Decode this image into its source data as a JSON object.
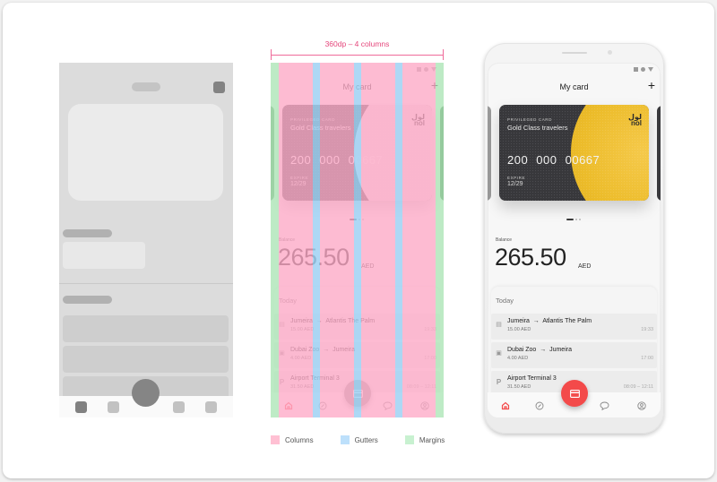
{
  "wireframe": {
    "transaction_rows": 3,
    "nav_items": 4,
    "active_nav_index": 0
  },
  "grid_spec": {
    "measure_label": "360dp – 4 columns",
    "columns": 4,
    "colors": {
      "columns": "#ffb6cc",
      "gutters": "#b4dbfa",
      "margins": "#c3efcc",
      "measure": "#ef6b9a"
    }
  },
  "legend": {
    "items": [
      {
        "label": "Columns",
        "color": "#ffc0d3"
      },
      {
        "label": "Gutters",
        "color": "#bde0fb"
      },
      {
        "label": "Margins",
        "color": "#c8f1d0"
      }
    ]
  },
  "app": {
    "title": "My card",
    "add_icon": "+",
    "status_icons": [
      "square-icon",
      "circle-icon",
      "triangle-icon"
    ],
    "card": {
      "type_label": "PRIVILEGED CARD",
      "name": "Gold Class travelers",
      "number": "200 000 00667",
      "expire_label": "EXPIRE",
      "expire_value": "12/29",
      "logo_text_1": "لول",
      "logo_text_2": "nol",
      "accent_color": "#ecbc2a",
      "base_color": "#38383b"
    },
    "pager": {
      "count": 3,
      "active": 0
    },
    "balance": {
      "label": "Balance",
      "value": "265.50",
      "currency": "AED"
    },
    "transactions_header": "Today",
    "transactions": [
      {
        "icon": "train-icon",
        "from": "Jumeira",
        "arrow": "→",
        "to": "Atlantis The Palm",
        "amount": "15.00 AED",
        "time": "19:33"
      },
      {
        "icon": "bus-icon",
        "from": "Dubai Zoo",
        "arrow": "→",
        "to": "Jumeira",
        "amount": "4.00 AED",
        "time": "17:00"
      },
      {
        "icon": "parking-icon",
        "from": "Airport Terminal 3",
        "arrow": "",
        "to": "",
        "amount": "31.50 AED",
        "time": "08:09 – 12:11"
      }
    ],
    "nav": {
      "items": [
        "home-icon",
        "explore-icon",
        "chat-icon",
        "profile-icon"
      ],
      "active_index": 0,
      "fab_icon": "card-icon",
      "accent_color": "#f34a4a"
    },
    "parking_glyph": "P"
  }
}
